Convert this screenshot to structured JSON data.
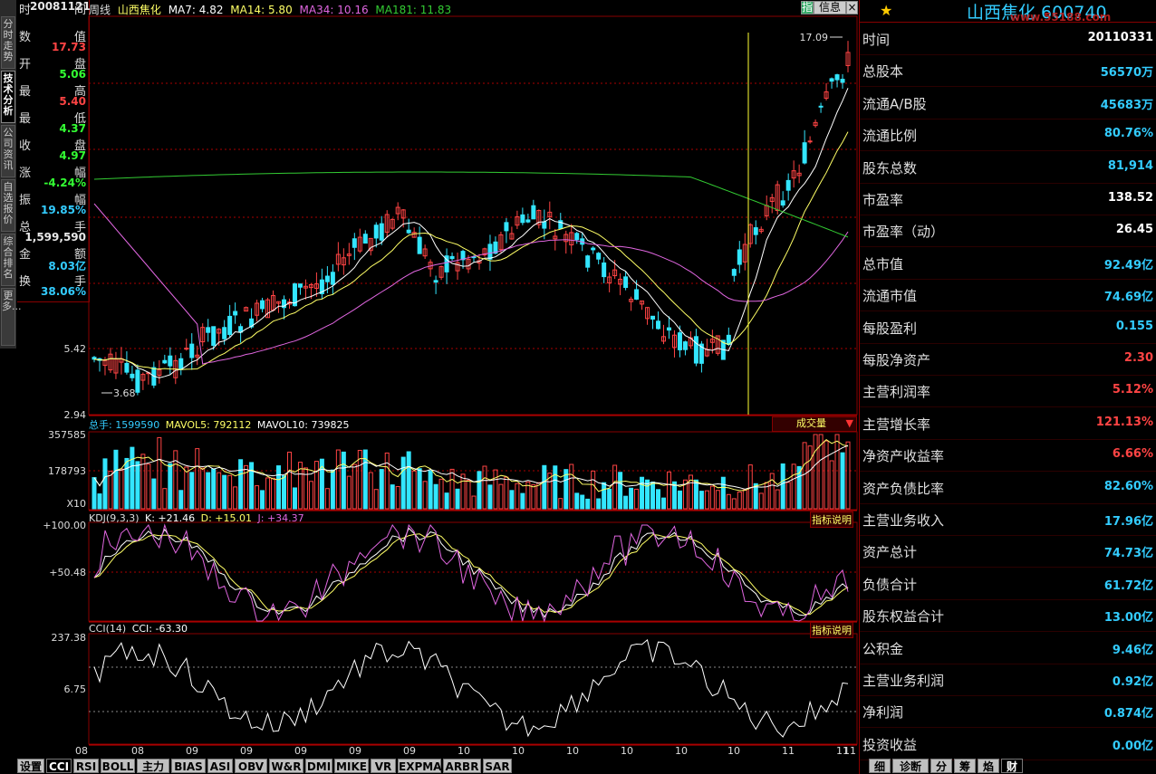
{
  "header": {
    "period": "周线",
    "stock_name": "山西焦化",
    "ma7": "MA7: 4.82",
    "ma14": "MA14: 5.80",
    "ma34": "MA34: 10.16",
    "ma181": "MA181: 11.83",
    "info_button": "信息",
    "pin_label": "指"
  },
  "left_nav": [
    "分时走势",
    "技术分析",
    "公司资讯",
    "自选报价",
    "综合排名",
    "更多..."
  ],
  "data_panel": {
    "rows": [
      {
        "label": "时",
        "label2": "间",
        "value": "20081121",
        "color": "#e8e8e8"
      },
      {
        "label": "数",
        "label2": "值",
        "value": "17.73",
        "color": "#ff4444"
      },
      {
        "label": "开",
        "label2": "盘",
        "value": "5.06",
        "color": "#33ff33"
      },
      {
        "label": "最",
        "label2": "高",
        "value": "5.40",
        "color": "#ff4444"
      },
      {
        "label": "最",
        "label2": "低",
        "value": "4.37",
        "color": "#33ff33"
      },
      {
        "label": "收",
        "label2": "盘",
        "value": "4.97",
        "color": "#33ff33"
      },
      {
        "label": "涨",
        "label2": "幅",
        "value": "-4.24%",
        "color": "#33ff33"
      },
      {
        "label": "振",
        "label2": "幅",
        "value": "19.85%",
        "color": "#33ccff"
      },
      {
        "label": "总",
        "label2": "手",
        "value": "1,599,590",
        "color": "#e8e8e8"
      },
      {
        "label": "金",
        "label2": "额",
        "value": "8.03亿",
        "color": "#33ccff"
      },
      {
        "label": "换",
        "label2": "手",
        "value": "38.06%",
        "color": "#33ccff"
      }
    ]
  },
  "price_chart": {
    "y_labels": [
      "5.42",
      "2.94"
    ],
    "high_label": "17.09",
    "low_label": "3.68"
  },
  "volume_chart": {
    "legend_total": "总手: 1599590",
    "legend_mavol5": "MAVOL5: 792112",
    "legend_mavol10": "MAVOL10: 739825",
    "y_labels": [
      "357585",
      "178793"
    ],
    "x10_label": "X10",
    "selector": "成交量"
  },
  "kdj_chart": {
    "legend_name": "KDJ(9,3,3)",
    "legend_k": "K: +21.46",
    "legend_d": "D: +15.01",
    "legend_j": "J: +34.37",
    "y_labels": [
      "+100.00",
      "+50.48"
    ],
    "help": "指标说明"
  },
  "cci_chart": {
    "legend_name": "CCI(14)",
    "legend_value": "CCI: -63.30",
    "y_labels": [
      "237.38",
      "6.75"
    ],
    "help": "指标说明"
  },
  "x_axis_labels": [
    "08",
    "08",
    "09",
    "09",
    "09",
    "09",
    "09",
    "10",
    "10",
    "10",
    "10",
    "10",
    "10",
    "11",
    "11",
    "11"
  ],
  "bottom_tabs": [
    "设置",
    "CCI",
    "RSI",
    "BOLL",
    "主力",
    "BIAS",
    "ASI",
    "OBV",
    "W&R",
    "DMI",
    "MIKE",
    "VR",
    "EXPMA",
    "ARBR",
    "SAR"
  ],
  "right_panel": {
    "title": "山西焦化 600740",
    "watermark": "www.55188.com",
    "rows": [
      {
        "label": "时间",
        "value": "20110331",
        "color": "#ffffff"
      },
      {
        "label": "总股本",
        "value": "56570万",
        "color": "#33ccff"
      },
      {
        "label": "流通A/B股",
        "value": "45683万",
        "color": "#33ccff"
      },
      {
        "label": "流通比例",
        "value": "80.76%",
        "color": "#33ccff"
      },
      {
        "label": "股东总数",
        "value": "81,914",
        "color": "#33ccff"
      },
      {
        "label": "市盈率",
        "value": "138.52",
        "color": "#ffffff"
      },
      {
        "label": "市盈率（动）",
        "value": "26.45",
        "color": "#ffffff"
      },
      {
        "label": "总市值",
        "value": "92.49亿",
        "color": "#33ccff"
      },
      {
        "label": "流通市值",
        "value": "74.69亿",
        "color": "#33ccff"
      },
      {
        "label": "每股盈利",
        "value": "0.155",
        "color": "#33ccff"
      },
      {
        "label": "每股净资产",
        "value": "2.30",
        "color": "#ff4444"
      },
      {
        "label": "主营利润率",
        "value": "5.12%",
        "color": "#ff4444"
      },
      {
        "label": "主营增长率",
        "value": "121.13%",
        "color": "#ff4444"
      },
      {
        "label": "净资产收益率",
        "value": "6.66%",
        "color": "#ff4444"
      },
      {
        "label": "资产负债比率",
        "value": "82.60%",
        "color": "#33ccff"
      },
      {
        "label": "主营业务收入",
        "value": "17.96亿",
        "color": "#33ccff"
      },
      {
        "label": "资产总计",
        "value": "74.73亿",
        "color": "#33ccff"
      },
      {
        "label": "负债合计",
        "value": "61.72亿",
        "color": "#33ccff"
      },
      {
        "label": "股东权益合计",
        "value": "13.00亿",
        "color": "#33ccff"
      },
      {
        "label": "公积金",
        "value": "9.46亿",
        "color": "#33ccff"
      },
      {
        "label": "主营业务利润",
        "value": "0.92亿",
        "color": "#33ccff"
      },
      {
        "label": "净利润",
        "value": "0.874亿",
        "color": "#33ccff"
      },
      {
        "label": "投资收益",
        "value": "0.00亿",
        "color": "#33ccff"
      }
    ],
    "tabs": [
      "细",
      "诊断",
      "分",
      "筹",
      "焰",
      "财"
    ]
  },
  "colors": {
    "up": "#ff4444",
    "down": "#33e6ff",
    "ma7": "#ffffff",
    "ma14": "#ffff66",
    "ma34": "#e066e0",
    "ma181": "#33cc33",
    "grid": "#aa0000"
  }
}
